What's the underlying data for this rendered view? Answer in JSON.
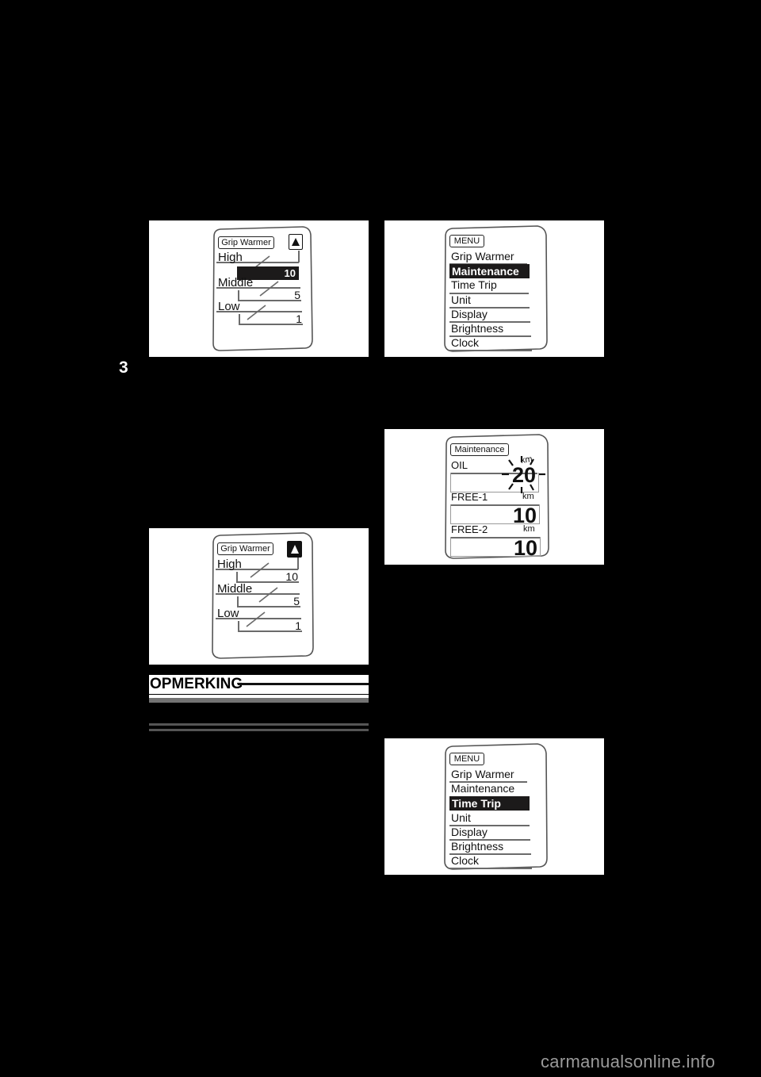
{
  "page": {
    "chapter_marker": "3",
    "background_color": "#000000",
    "watermark": "carmanualsonline.info"
  },
  "figures": [
    {
      "id": "grip-warmer-adjust",
      "panel_title": "Grip Warmer",
      "indicator_icon": "arrow-up-outline-icon",
      "levels": [
        {
          "label": "High",
          "value": "10",
          "highlighted": true
        },
        {
          "label": "Middle",
          "value": "5",
          "highlighted": false
        },
        {
          "label": "Low",
          "value": "1",
          "highlighted": false
        }
      ]
    },
    {
      "id": "menu-maintenance-selected",
      "panel_title": "MENU",
      "items": [
        {
          "label": "Grip Warmer",
          "selected": false
        },
        {
          "label": "Maintenance",
          "selected": true
        },
        {
          "label": "Time Trip",
          "selected": false
        },
        {
          "label": "Unit",
          "selected": false
        },
        {
          "label": "Display",
          "selected": false
        },
        {
          "label": "Brightness",
          "selected": false
        },
        {
          "label": "Clock",
          "selected": false
        }
      ]
    },
    {
      "id": "grip-warmer-confirm",
      "panel_title": "Grip Warmer",
      "indicator_icon": "arrow-up-filled-icon",
      "levels": [
        {
          "label": "High",
          "value": "10",
          "highlighted": false
        },
        {
          "label": "Middle",
          "value": "5",
          "highlighted": false
        },
        {
          "label": "Low",
          "value": "1",
          "highlighted": false
        }
      ]
    },
    {
      "id": "maintenance-screen",
      "panel_title": "Maintenance",
      "rows": [
        {
          "label": "OIL",
          "unit": "km",
          "value": "20",
          "flashing": true
        },
        {
          "label": "FREE-1",
          "unit": "km",
          "value": "10",
          "flashing": false
        },
        {
          "label": "FREE-2",
          "unit": "km",
          "value": "10",
          "flashing": false
        }
      ]
    },
    {
      "id": "menu-time-trip-selected",
      "panel_title": "MENU",
      "items": [
        {
          "label": "Grip Warmer",
          "selected": false
        },
        {
          "label": "Maintenance",
          "selected": false
        },
        {
          "label": "Time Trip",
          "selected": true
        },
        {
          "label": "Unit",
          "selected": false
        },
        {
          "label": "Display",
          "selected": false
        },
        {
          "label": "Brightness",
          "selected": false
        },
        {
          "label": "Clock",
          "selected": false
        }
      ]
    }
  ],
  "note": {
    "title": "OPMERKING"
  }
}
